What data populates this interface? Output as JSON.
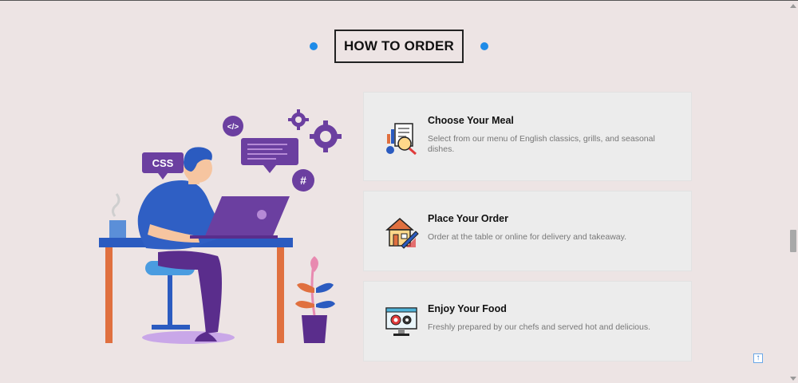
{
  "section": {
    "title": "HOW TO ORDER"
  },
  "illustration": {
    "css_badge": "CSS",
    "code_badge": "</>",
    "hash_badge": "#"
  },
  "steps": [
    {
      "title": "Choose Your Meal",
      "text": "Select from our menu of English classics, grills, and seasonal dishes.",
      "icon": "menu-search-icon"
    },
    {
      "title": "Place Your Order",
      "text": "Order at the table or online for delivery and takeaway.",
      "icon": "house-blueprint-icon"
    },
    {
      "title": "Enjoy Your Food",
      "text": "Freshly prepared by our chefs and served hot and delicious.",
      "icon": "monitor-gears-icon"
    }
  ],
  "controls": {
    "back_to_top": "↑"
  },
  "colors": {
    "accent_dot": "#1e8be8",
    "background": "#ede4e4",
    "card_bg": "#ececec",
    "purple": "#6b3fa0",
    "blue_shirt": "#2f5fc4"
  }
}
